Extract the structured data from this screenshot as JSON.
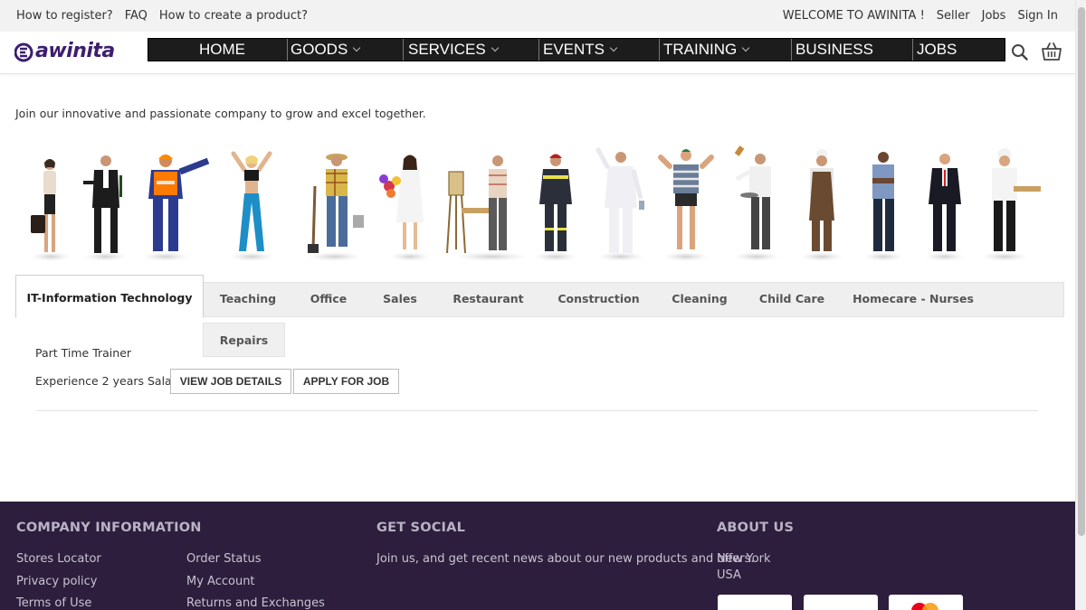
{
  "topbar": {
    "left_links": [
      "How to register?",
      "FAQ",
      "How to create a product?"
    ],
    "welcome": "WELCOME TO AWINITA !",
    "right_links": [
      "Seller",
      "Jobs",
      "Sign In"
    ]
  },
  "header": {
    "logo_text": "awinita",
    "brand_color": "#3d1e6e",
    "nav": [
      {
        "label": "HOME",
        "dropdown": false
      },
      {
        "label": "GOODS",
        "dropdown": true
      },
      {
        "label": "SERVICES",
        "dropdown": true
      },
      {
        "label": "EVENTS",
        "dropdown": true
      },
      {
        "label": "TRAINING",
        "dropdown": true
      },
      {
        "label": "BUSINESS",
        "dropdown": false
      },
      {
        "label": "JOBS",
        "dropdown": false
      }
    ],
    "icons": [
      "search-icon",
      "basket-icon"
    ]
  },
  "main": {
    "intro": "Join our innovative and passionate company to grow and excel together.",
    "tabs": [
      "IT-Information Technology",
      "Teaching",
      "Office",
      "Sales",
      "Restaurant",
      "Construction",
      "Cleaning",
      "Child Care",
      "Homecare - Nurses",
      "Repairs"
    ],
    "active_tab": "IT-Information Technology",
    "job": {
      "title": "Part Time Trainer",
      "experience": "Experience 2 years Salary",
      "view_label": "VIEW JOB DETAILS",
      "apply_label": "APPLY FOR JOB"
    }
  },
  "footer": {
    "background": "#2c1e3c",
    "company": {
      "heading": "COMPANY INFORMATION",
      "col1": [
        "Stores Locator",
        "Privacy policy",
        "Terms of Use"
      ],
      "col2": [
        "Order Status",
        "My Account",
        "Returns and Exchanges"
      ]
    },
    "social": {
      "heading": "GET SOCIAL",
      "text": "Join us, and get recent news about our new products and offers."
    },
    "about": {
      "heading": "ABOUT US",
      "city": "New York",
      "country": "USA"
    }
  }
}
